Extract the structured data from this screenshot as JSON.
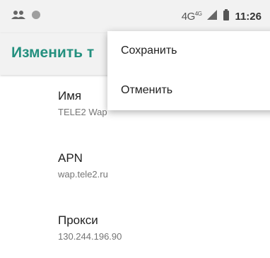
{
  "status_bar": {
    "network_label": "4G",
    "network_sup": "4G",
    "time": "11:26",
    "icons": [
      "people-icon",
      "circle-icon",
      "signal-icon",
      "battery-icon"
    ]
  },
  "app_bar": {
    "title": "Изменить т"
  },
  "preferences": [
    {
      "title": "Имя",
      "summary": "TELE2 Wap"
    },
    {
      "title": "APN",
      "summary": "wap.tele2.ru"
    },
    {
      "title": "Прокси",
      "summary": "130.244.196.90"
    }
  ],
  "menu": {
    "items": [
      {
        "label": "Сохранить"
      },
      {
        "label": "Отменить"
      }
    ]
  },
  "colors": {
    "accent": "#24907f",
    "bar_background": "#f2f2f2"
  }
}
